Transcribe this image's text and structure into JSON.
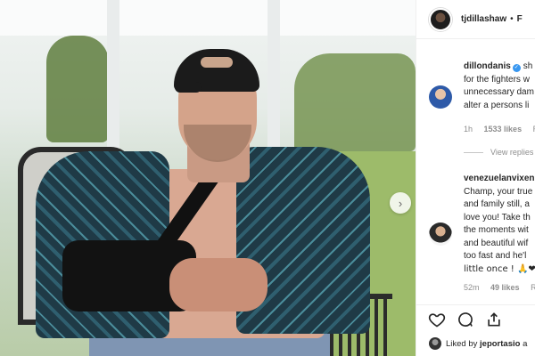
{
  "post": {
    "username": "tjdillashaw",
    "separator": "•",
    "follow_label": "F",
    "next_label": "›"
  },
  "comments": [
    {
      "username": "dillondanis",
      "verified": true,
      "lines": [
        "sh",
        "for the fighters w",
        "unnecessary dam",
        "alter a persons li"
      ],
      "time": "1h",
      "likes": "1533 likes",
      "reply_label": "R",
      "view_replies": "View replies"
    },
    {
      "username": "venezuelanvixen",
      "verified": false,
      "lines": [
        "Champ, your true",
        "and family still, a",
        "love you! Take th",
        "the moments wit",
        "and beautiful wif",
        "too fast and he'l",
        "little once ! 🙏❤"
      ],
      "time": "52m",
      "likes": "49 likes",
      "reply_label": "R"
    }
  ],
  "actions": {
    "like_icon": "heart-icon",
    "comment_icon": "comment-icon",
    "share_icon": "share-icon"
  },
  "liked_by": {
    "prefix": "Liked by",
    "username": "jeportasio",
    "suffix": "a"
  }
}
